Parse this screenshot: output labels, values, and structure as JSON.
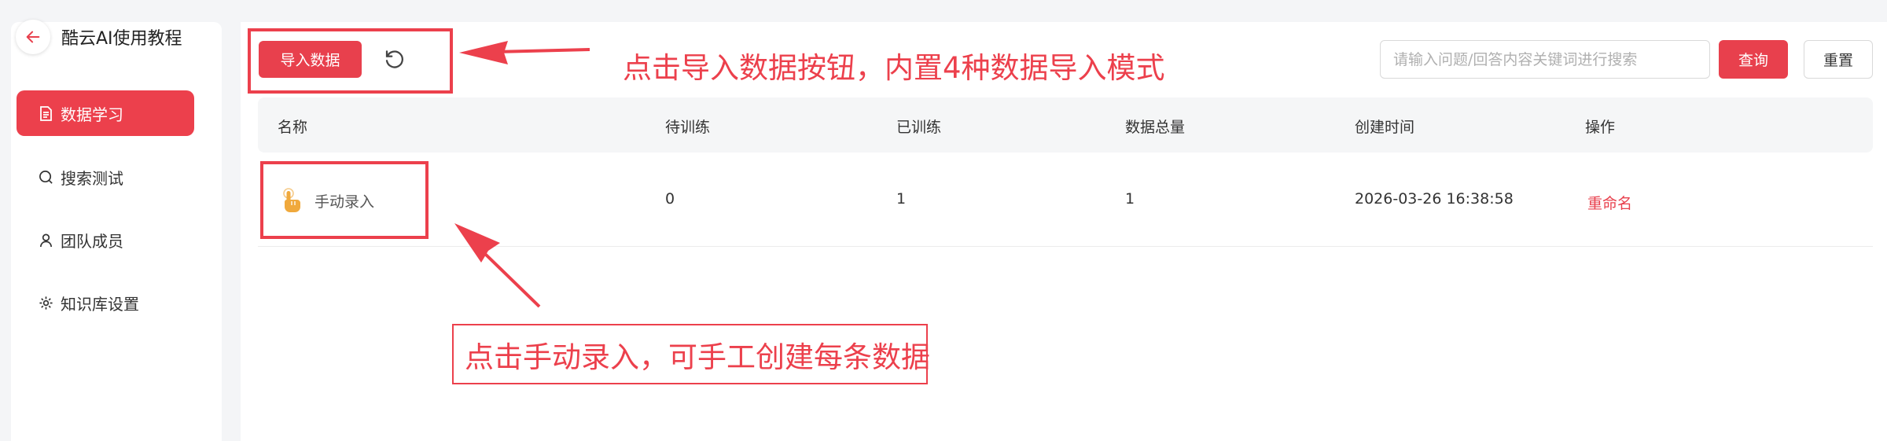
{
  "sidebar": {
    "title": "酷云AI使用教程",
    "items": [
      {
        "label": "数据学习",
        "icon": "document-icon",
        "active": true
      },
      {
        "label": "搜索测试",
        "icon": "search-icon",
        "active": false
      },
      {
        "label": "团队成员",
        "icon": "user-icon",
        "active": false
      },
      {
        "label": "知识库设置",
        "icon": "gear-icon",
        "active": false
      }
    ]
  },
  "toolbar": {
    "import_label": "导入数据",
    "search_placeholder": "请输入问题/回答内容关键词进行搜索",
    "search_value": "",
    "query_label": "查询",
    "reset_label": "重置"
  },
  "table": {
    "columns": [
      "名称",
      "待训练",
      "已训练",
      "数据总量",
      "创建时间",
      "操作"
    ],
    "rows": [
      {
        "name": "手动录入",
        "pending": "0",
        "trained": "1",
        "total": "1",
        "created": "2026-03-26 16:38:58",
        "action": "重命名"
      }
    ]
  },
  "annotations": {
    "import_hint": "点击导入数据按钮，内置4种数据导入模式",
    "manual_hint": "点击手动录入，可手工创建每条数据"
  },
  "colors": {
    "accent": "#e8404d",
    "annotation": "#ec404c",
    "background": "#f4f5f7",
    "hand_icon": "#f0a93c"
  }
}
